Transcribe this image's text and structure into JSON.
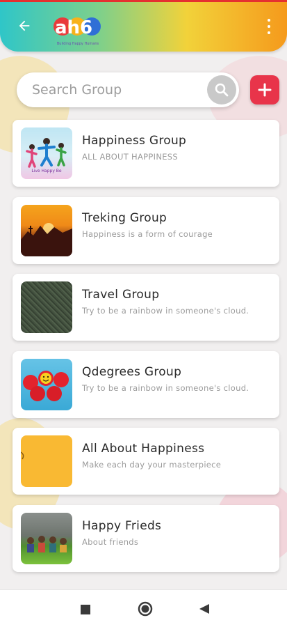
{
  "header": {
    "logo_text": "ah6",
    "logo_tagline": "Building Happy Humans",
    "colors": {
      "gradient_start": "#2fc6c8",
      "gradient_end": "#f59a1c"
    },
    "back_icon": "arrow-left-icon",
    "menu_icon": "more-vertical-icon"
  },
  "search": {
    "placeholder": "Search Group",
    "icon": "search-icon"
  },
  "add_button": {
    "icon": "plus-icon",
    "color": "#e8344a"
  },
  "groups": [
    {
      "title": "Happiness Group",
      "subtitle": "ALL ABOUT HAPPINESS",
      "thumb_text": "Live Happy Be"
    },
    {
      "title": "Treking Group",
      "subtitle": "Happiness is a form of courage"
    },
    {
      "title": "Travel Group",
      "subtitle": "Try to be a rainbow in someone's cloud."
    },
    {
      "title": "Qdegrees Group",
      "subtitle": "Try to be a rainbow in someone's cloud."
    },
    {
      "title": "All About Happiness",
      "subtitle": "Make each day your masterpiece"
    },
    {
      "title": "Happy Frieds",
      "subtitle": "About friends"
    }
  ],
  "navbar": {
    "recents_icon": "square-icon",
    "home_icon": "circle-icon",
    "back_icon": "triangle-left-icon"
  }
}
